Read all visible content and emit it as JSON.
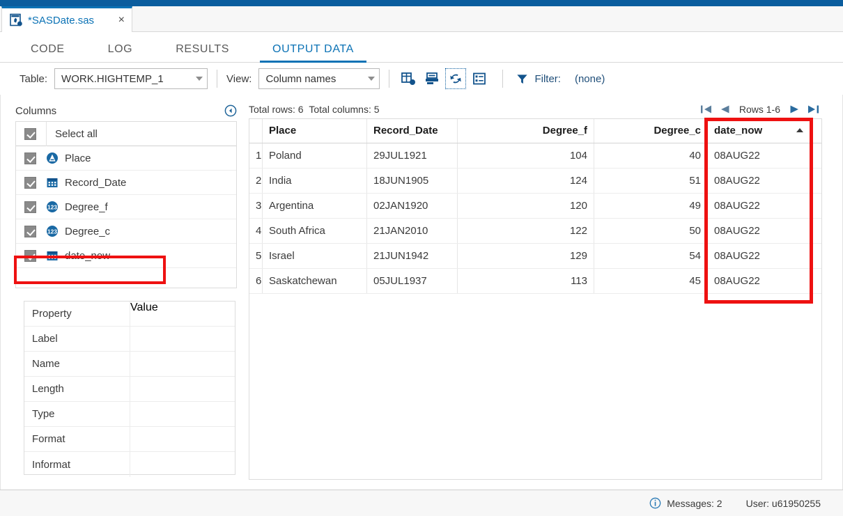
{
  "window": {
    "accent_color": "#0b72b5",
    "appbar_color": "#0b5d9e",
    "highlight_color": "#ee1111"
  },
  "document_tab": {
    "icon": "sas-program-icon",
    "name": "*SASDate.sas",
    "close_label": "×"
  },
  "section_tabs": [
    {
      "label": "CODE",
      "active": false
    },
    {
      "label": "LOG",
      "active": false
    },
    {
      "label": "RESULTS",
      "active": false
    },
    {
      "label": "OUTPUT DATA",
      "active": true
    }
  ],
  "toolbar": {
    "table_label": "Table:",
    "table_value": "WORK.HIGHTEMP_1",
    "view_label": "View:",
    "view_value": "Column names",
    "icons": [
      {
        "name": "new-filtered-table-icon",
        "selected": false
      },
      {
        "name": "save-table-icon",
        "selected": false
      },
      {
        "name": "refresh-icon",
        "selected": true
      },
      {
        "name": "column-properties-icon",
        "selected": false
      }
    ],
    "filter_icon": "filter-icon",
    "filter_label": "Filter:",
    "filter_value": "(none)"
  },
  "columns_panel": {
    "title": "Columns",
    "collapse_icon": "collapse-left-icon",
    "select_all_label": "Select all",
    "items": [
      {
        "label": "Place",
        "type_icon": "char-column-icon",
        "checked": true,
        "highlighted": false
      },
      {
        "label": "Record_Date",
        "type_icon": "date-column-icon",
        "checked": true,
        "highlighted": false
      },
      {
        "label": "Degree_f",
        "type_icon": "num-column-icon",
        "checked": true,
        "highlighted": false
      },
      {
        "label": "Degree_c",
        "type_icon": "num-column-icon",
        "checked": true,
        "highlighted": false
      },
      {
        "label": "date_now",
        "type_icon": "date-column-icon",
        "checked": true,
        "highlighted": true
      }
    ]
  },
  "properties_panel": {
    "header": {
      "property": "Property",
      "value": "Value"
    },
    "rows": [
      {
        "property": "Label",
        "value": ""
      },
      {
        "property": "Name",
        "value": ""
      },
      {
        "property": "Length",
        "value": ""
      },
      {
        "property": "Type",
        "value": ""
      },
      {
        "property": "Format",
        "value": ""
      },
      {
        "property": "Informat",
        "value": ""
      }
    ]
  },
  "grid": {
    "total_rows_label": "Total rows: 6",
    "total_columns_label": "Total columns: 5",
    "pager": {
      "first_icon": "first-page-icon",
      "prev_icon": "previous-page-icon",
      "range_label": "Rows 1-6",
      "next_icon": "next-page-icon",
      "last_icon": "last-page-icon"
    },
    "headers": {
      "place": "Place",
      "record_date": "Record_Date",
      "degree_f": "Degree_f",
      "degree_c": "Degree_c",
      "date_now": "date_now"
    },
    "sorted_column": "date_now",
    "sort_direction": "ascending",
    "rows": [
      {
        "n": "1",
        "place": "Poland",
        "record_date": "29JUL1921",
        "degree_f": "104",
        "degree_c": "40",
        "date_now": "08AUG22"
      },
      {
        "n": "2",
        "place": "India",
        "record_date": "18JUN1905",
        "degree_f": "124",
        "degree_c": "51",
        "date_now": "08AUG22"
      },
      {
        "n": "3",
        "place": "Argentina",
        "record_date": "02JAN1920",
        "degree_f": "120",
        "degree_c": "49",
        "date_now": "08AUG22"
      },
      {
        "n": "4",
        "place": "South Africa",
        "record_date": "21JAN2010",
        "degree_f": "122",
        "degree_c": "50",
        "date_now": "08AUG22"
      },
      {
        "n": "5",
        "place": "Israel",
        "record_date": "21JUN1942",
        "degree_f": "129",
        "degree_c": "54",
        "date_now": "08AUG22"
      },
      {
        "n": "6",
        "place": "Saskatchewan",
        "record_date": "05JUL1937",
        "degree_f": "113",
        "degree_c": "45",
        "date_now": "08AUG22"
      }
    ]
  },
  "status_bar": {
    "messages_icon": "info-icon",
    "messages_label": "Messages: 2",
    "user_label": "User: u61950255"
  }
}
